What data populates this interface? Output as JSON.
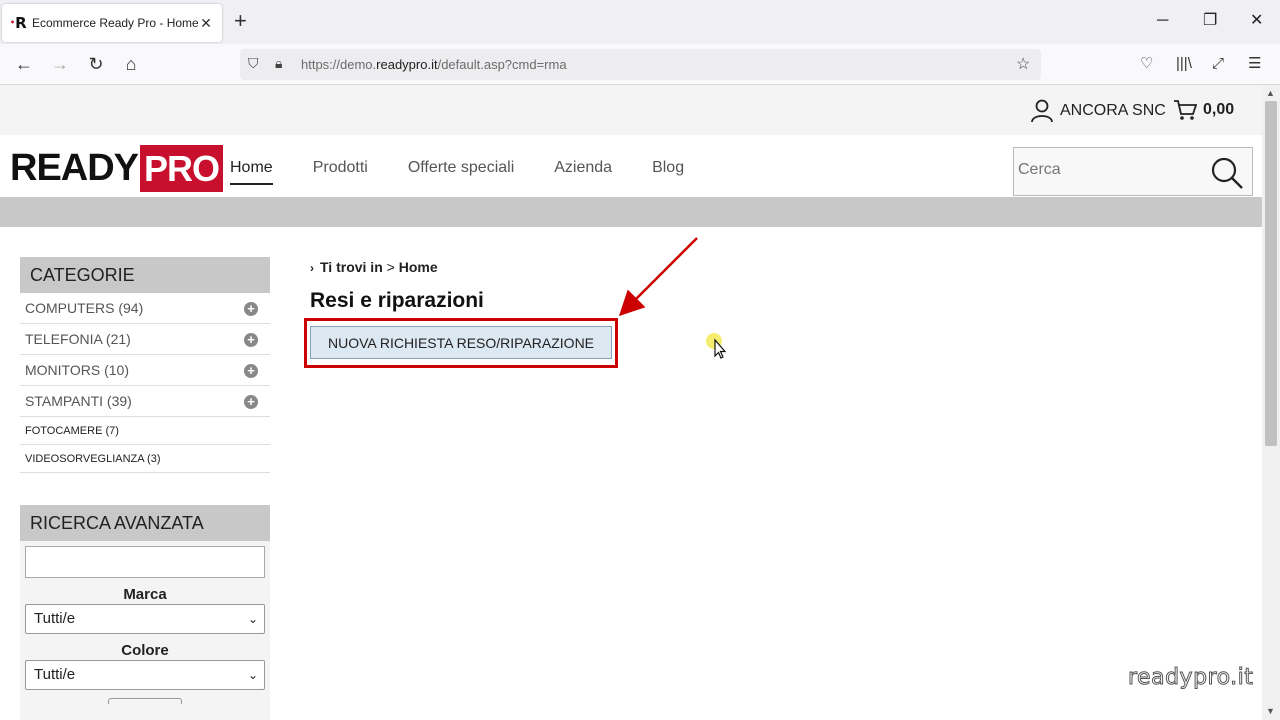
{
  "browser": {
    "tab_title": "Ecommerce Ready Pro - Home",
    "url_prefix": "https://demo.",
    "url_domain": "readypro.it",
    "url_path": "/default.asp?cmd=rma"
  },
  "topbar": {
    "account_name": "ANCORA SNC",
    "cart_total": "0,00"
  },
  "header": {
    "logo_left": "READY",
    "logo_right": "PRO",
    "menu": [
      "Home",
      "Prodotti",
      "Offerte speciali",
      "Azienda",
      "Blog"
    ],
    "search_placeholder": "Cerca"
  },
  "sidebar": {
    "categories_title": "CATEGORIE",
    "categories": [
      {
        "label": "COMPUTERS (94)"
      },
      {
        "label": "TELEFONIA (21)"
      },
      {
        "label": "MONITORS (10)"
      },
      {
        "label": "STAMPANTI (39)"
      },
      {
        "label": "FOTOCAMERE (7)"
      },
      {
        "label": "VIDEOSORVEGLIANZA (3)"
      }
    ],
    "advanced_title": "RICERCA AVANZATA",
    "brand_label": "Marca",
    "brand_value": "Tutti/e",
    "color_label": "Colore",
    "color_value": "Tutti/e"
  },
  "content": {
    "breadcrumb_prefix": "Ti trovi in",
    "breadcrumb_sep": ">",
    "breadcrumb_current": "Home",
    "title": "Resi e riparazioni",
    "new_request_button": "NUOVA RICHIESTA RESO/RIPARAZIONE"
  },
  "watermark": "readypro.it",
  "colors": {
    "brand_red": "#c8102e",
    "annotation_red": "#cc0000",
    "button_bg": "#dce8f2"
  }
}
